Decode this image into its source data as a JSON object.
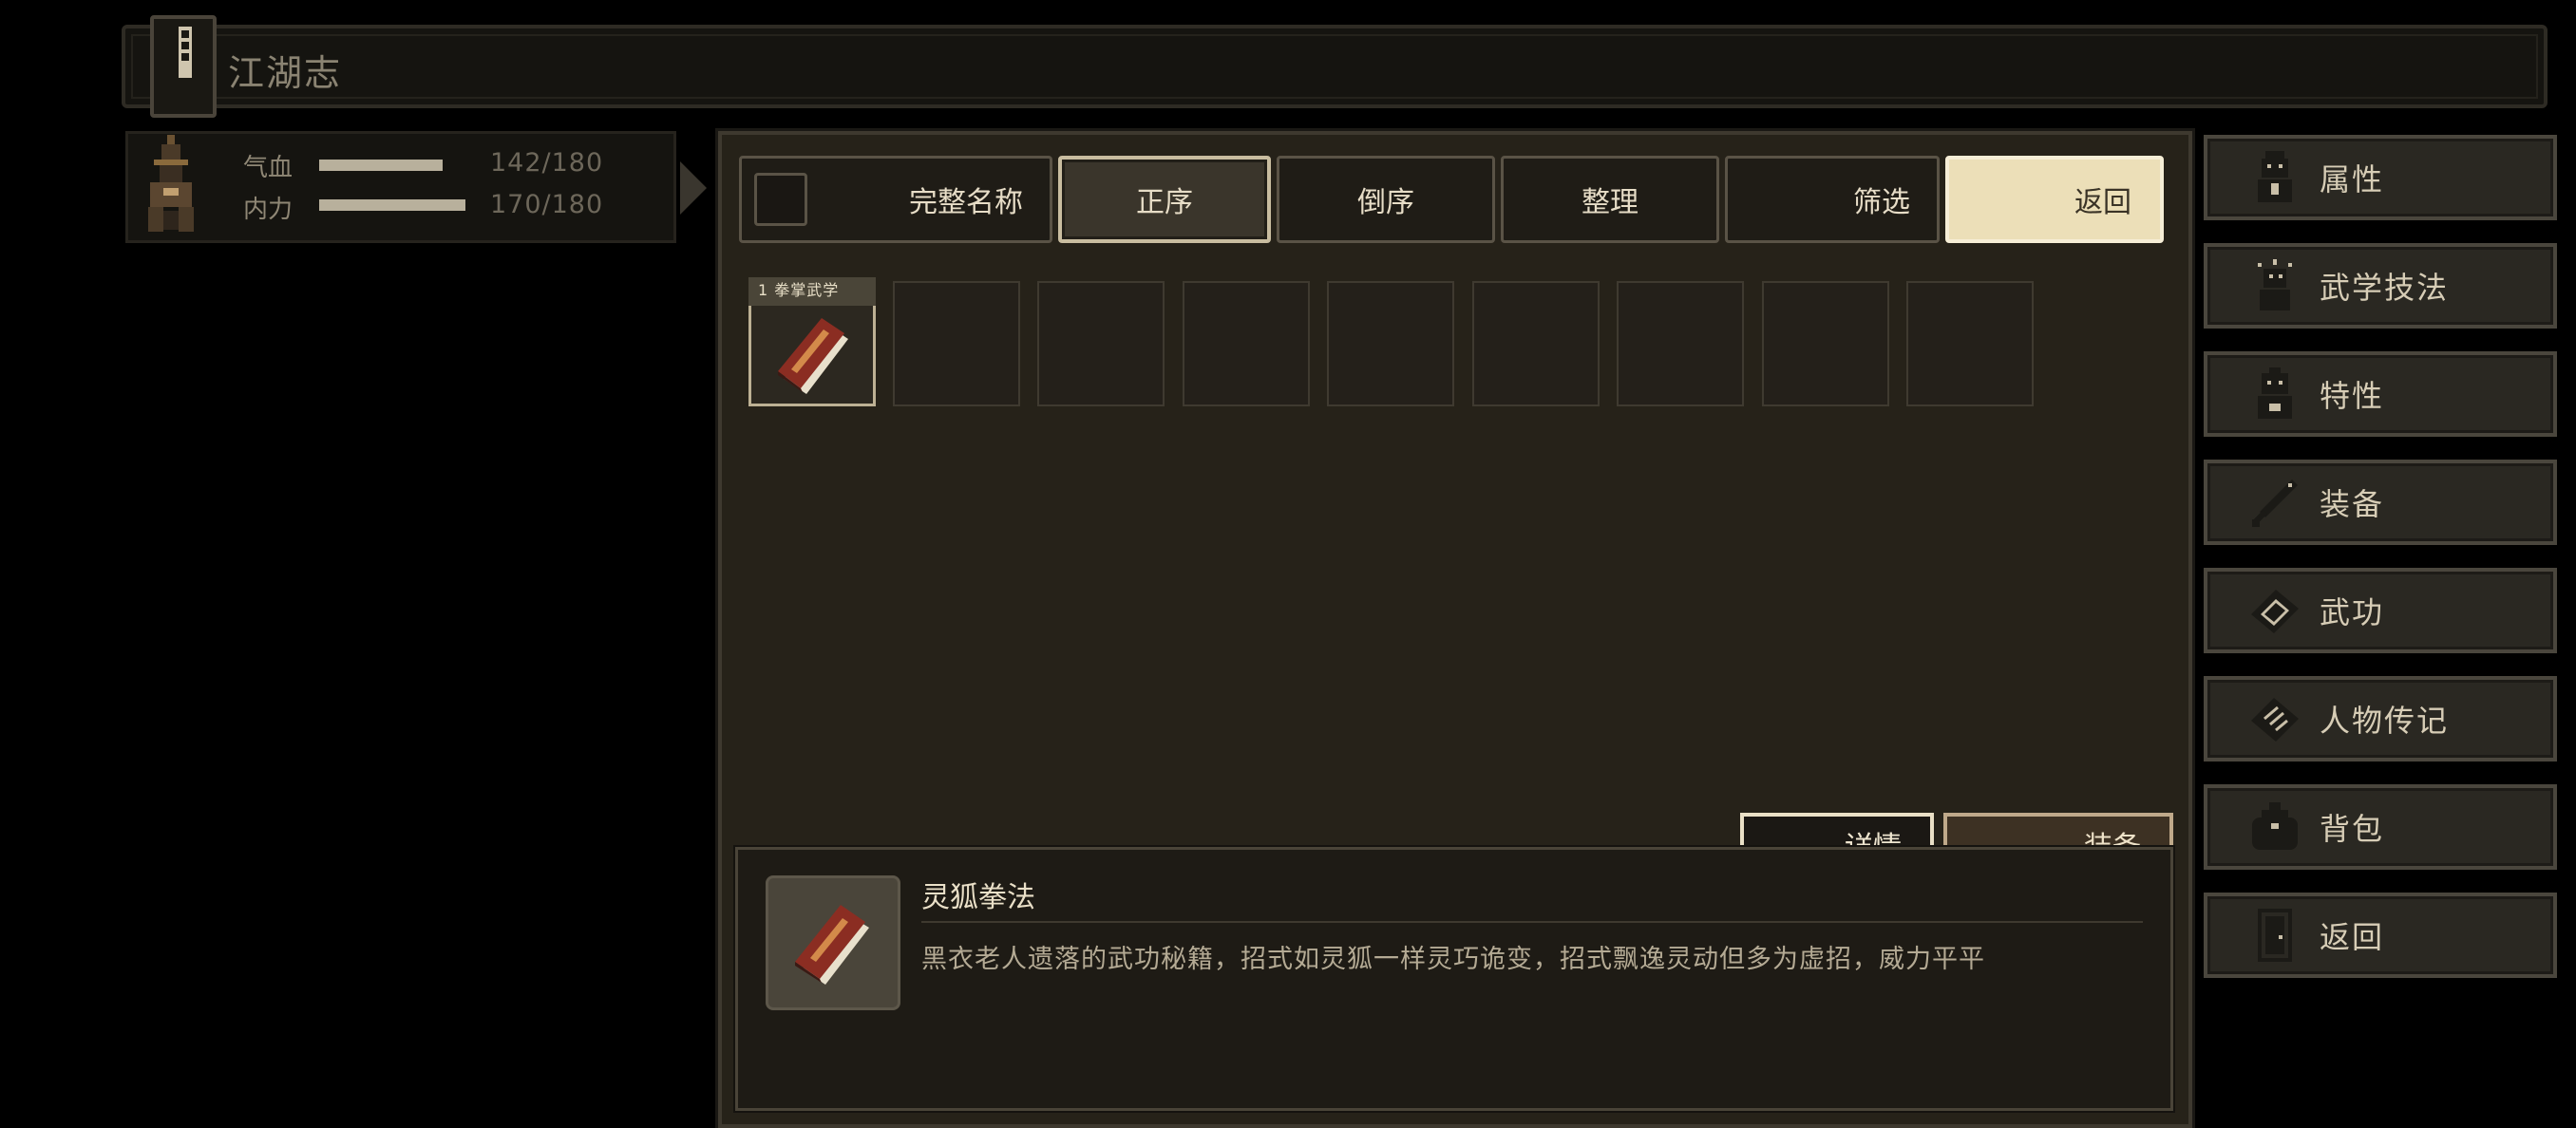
{
  "title": {
    "text": "江湖志"
  },
  "character": {
    "hp": {
      "label": "气血",
      "value": "142/180",
      "fraction": 0.79
    },
    "mp": {
      "label": "内力",
      "value": "170/180",
      "fraction": 0.94
    }
  },
  "toolbar": {
    "name_label": "完整名称",
    "asc_label": "正序",
    "desc_label": "倒序",
    "sort_label": "整理",
    "filter_label": "筛选",
    "return_label": "返回"
  },
  "inventory": {
    "slot_count": 9,
    "selected_tag": "1 拳掌武学"
  },
  "detail": {
    "name": "灵狐拳法",
    "description": "黑衣老人遗落的武功秘籍，招式如灵狐一样灵巧诡变，招式飘逸灵动但多为虚招，威力平平",
    "detail_button": "详情",
    "equip_button": "装备"
  },
  "menu": {
    "items": [
      {
        "label": "属性",
        "icon": "person-icon"
      },
      {
        "label": "武学技法",
        "icon": "martial-figure-icon"
      },
      {
        "label": "特性",
        "icon": "trait-figure-icon"
      },
      {
        "label": "装备",
        "icon": "sword-icon"
      },
      {
        "label": "武功",
        "icon": "book-icon"
      },
      {
        "label": "人物传记",
        "icon": "biography-scroll-icon"
      },
      {
        "label": "背包",
        "icon": "bag-icon"
      },
      {
        "label": "返回",
        "icon": "door-icon"
      }
    ]
  },
  "colors": {
    "accent_cream": "#ecdfb8",
    "panel_bg": "#262219",
    "book_red": "#8b2d22"
  }
}
